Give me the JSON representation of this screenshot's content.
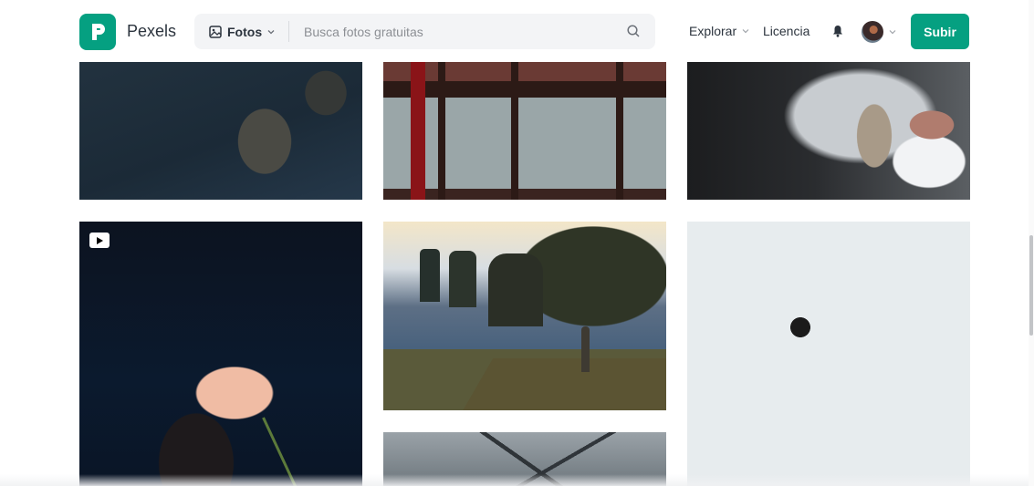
{
  "header": {
    "brand": "Pexels",
    "search": {
      "type_label": "Fotos",
      "placeholder": "Busca fotos gratuitas"
    },
    "nav": {
      "explore": "Explorar",
      "license": "Licencia",
      "upload": "Subir"
    }
  },
  "gallery": {
    "items": [
      {
        "kind": "photo"
      },
      {
        "kind": "photo"
      },
      {
        "kind": "photo"
      },
      {
        "kind": "video"
      },
      {
        "kind": "photo"
      },
      {
        "kind": "photo"
      },
      {
        "kind": "photo"
      }
    ]
  },
  "colors": {
    "brand": "#05a081",
    "text": "#2c343e",
    "search_bg": "#f3f4f6"
  },
  "icons": [
    "pexels-logo-icon",
    "image-icon",
    "chevron-down-icon",
    "search-icon",
    "bell-icon",
    "play-icon"
  ]
}
